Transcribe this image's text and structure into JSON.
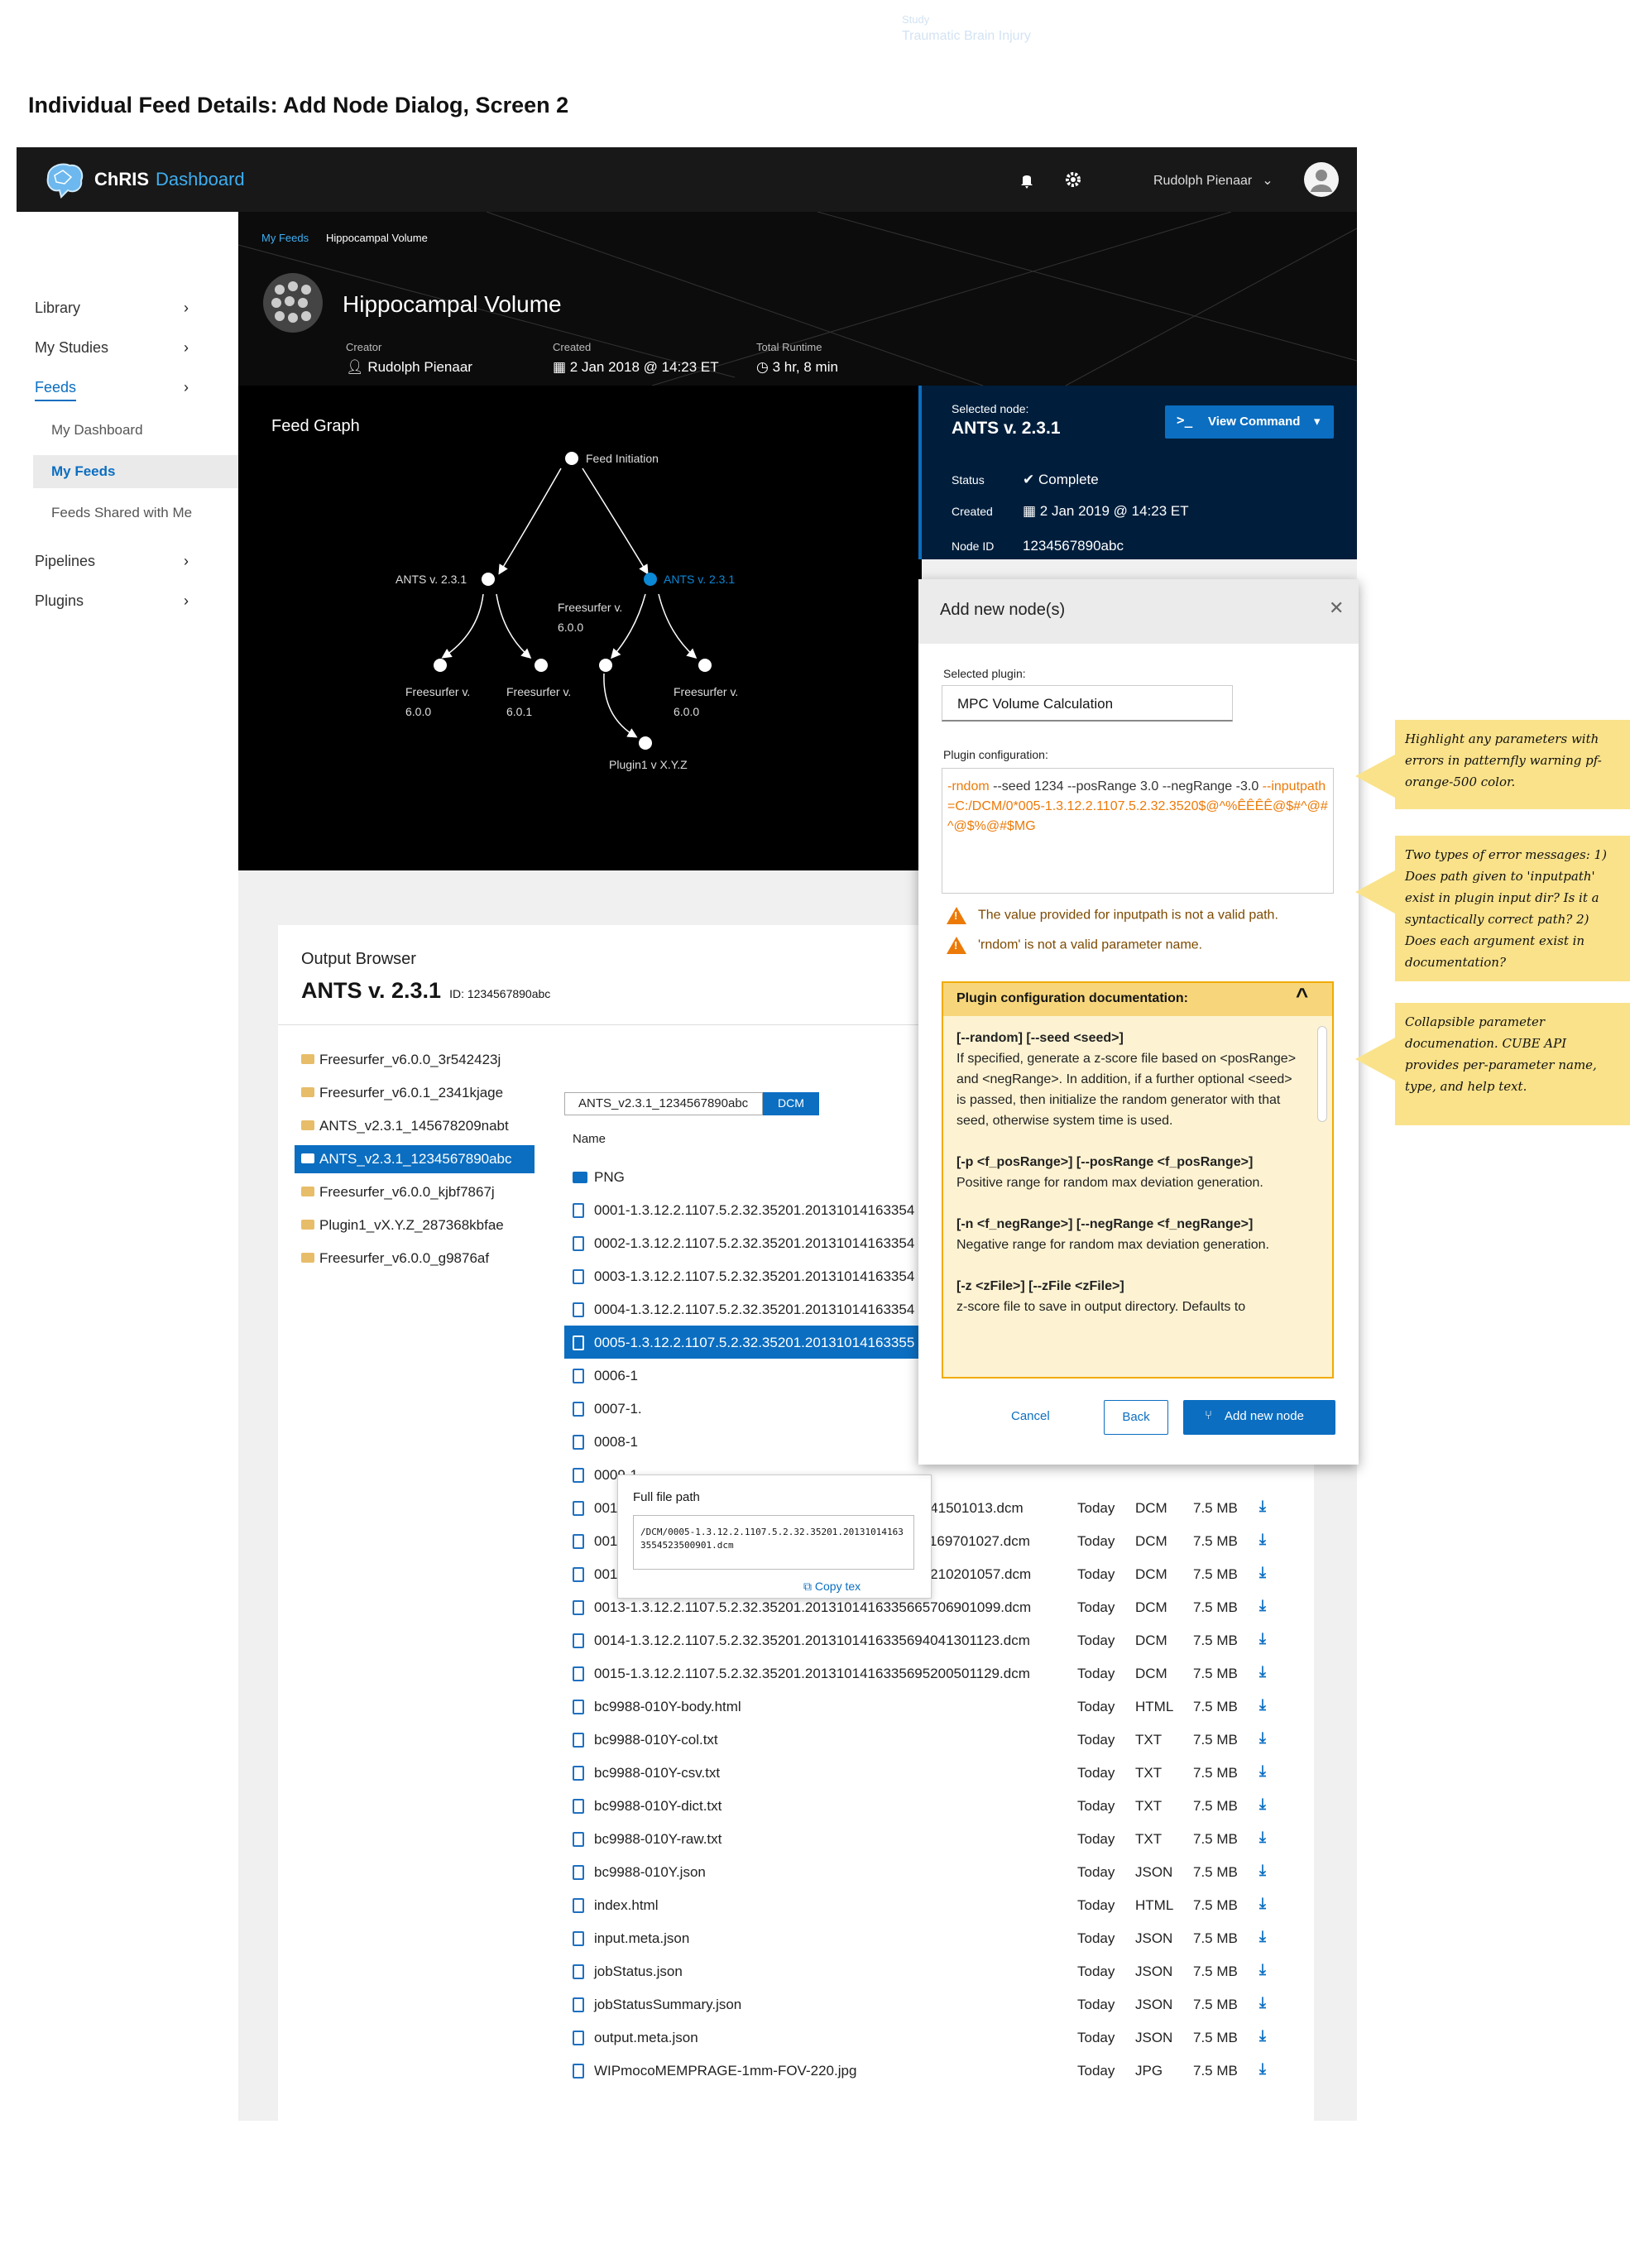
{
  "ghost": {
    "label": "Study",
    "name": "Traumatic Brain Injury"
  },
  "page_title": "Individual Feed Details: Add Node Dialog, Screen 2",
  "masthead": {
    "brand": "ChRIS",
    "brand_suffix": "Dashboard",
    "user": "Rudolph Pienaar"
  },
  "sidebar": {
    "items": [
      {
        "label": "Library"
      },
      {
        "label": "My Studies"
      },
      {
        "label": "Feeds"
      },
      {
        "label": "Pipelines"
      },
      {
        "label": "Plugins"
      }
    ],
    "sub": [
      {
        "label": "My Dashboard"
      },
      {
        "label": "My Feeds"
      },
      {
        "label": "Feeds Shared with Me"
      }
    ]
  },
  "breadcrumb": {
    "parent": "My Feeds",
    "current": "Hippocampal Volume"
  },
  "feed": {
    "title": "Hippocampal Volume",
    "creator_label": "Creator",
    "creator": "Rudolph Pienaar",
    "created_label": "Created",
    "created": "2 Jan 2018 @ 14:23 ET",
    "runtime_label": "Total Runtime",
    "runtime": "3 hr, 8 min"
  },
  "graph": {
    "title": "Feed Graph",
    "nodes": [
      {
        "label": "Feed Initiation"
      },
      {
        "label": "ANTS v. 2.3.1"
      },
      {
        "label": "ANTS v. 2.3.1"
      },
      {
        "label": "Freesurfer v. 6.0.0"
      },
      {
        "label": "Freesurfer v. 6.0.1"
      },
      {
        "label": "Freesurfer v. 6.0.0"
      },
      {
        "label": "Freesurfer v. 6.0.0"
      },
      {
        "label": "Plugin1 v X.Y.Z"
      }
    ]
  },
  "selected": {
    "label": "Selected node:",
    "name": "ANTS v. 2.3.1",
    "view_command": "View Command",
    "status_label": "Status",
    "status": "Complete",
    "created_label": "Created",
    "created": "2 Jan 2019 @ 14:23 ET",
    "nodeid_label": "Node ID",
    "nodeid": "1234567890abc"
  },
  "output": {
    "title": "Output Browser",
    "name": "ANTS v. 2.3.1",
    "id": "ID: 1234567890abc",
    "path": "ANTS_v2.3.1_1234567890abc",
    "tag": "DCM",
    "name_header": "Name",
    "folders": [
      "Freesurfer_v6.0.0_3r542423j",
      "Freesurfer_v6.0.1_2341kjage",
      "ANTS_v2.3.1_145678209nabt",
      "ANTS_v2.3.1_1234567890abc",
      "Freesurfer_v6.0.0_kjbf7867j",
      "Plugin1_vX.Y.Z_287368kbfae",
      "Freesurfer_v6.0.0_g9876af"
    ],
    "files": [
      {
        "name": "PNG",
        "date": "",
        "type": "",
        "size": ""
      },
      {
        "name": "0001-1.3.12.2.1107.5.2.32.35201.20131014163354",
        "date": "",
        "type": "",
        "size": ""
      },
      {
        "name": "0002-1.3.12.2.1107.5.2.32.35201.20131014163354",
        "date": "",
        "type": "",
        "size": ""
      },
      {
        "name": "0003-1.3.12.2.1107.5.2.32.35201.20131014163354",
        "date": "",
        "type": "",
        "size": ""
      },
      {
        "name": "0004-1.3.12.2.1107.5.2.32.35201.20131014163354",
        "date": "",
        "type": "",
        "size": ""
      },
      {
        "name": "0005-1.3.12.2.1107.5.2.32.35201.20131014163355",
        "date": "",
        "type": "",
        "size": ""
      },
      {
        "name": "0006-1",
        "date": "",
        "type": "",
        "size": ""
      },
      {
        "name": "0007-1.",
        "date": "",
        "type": "",
        "size": ""
      },
      {
        "name": "0008-1",
        "date": "",
        "type": "",
        "size": ""
      },
      {
        "name": "0009-1",
        "date": "",
        "type": "",
        "size": ""
      },
      {
        "name": "0010-1.3.12.2.1107.5.2.32.35201.2013101416335623415010​13.dcm",
        "date": "Today",
        "type": "DCM",
        "size": "7.5 MB"
      },
      {
        "name": "0011-1.3.12.2.1107.5.2.32.35201.2013101416335613169701027.dcm",
        "date": "Today",
        "type": "DCM",
        "size": "7.5 MB"
      },
      {
        "name": "0012-1.3.12.2.1107.5.2.32.35201.2013101416335632210201057.dcm",
        "date": "Today",
        "type": "DCM",
        "size": "7.5 MB"
      },
      {
        "name": "0013-1.3.12.2.1107.5.2.32.35201.2013101416335665706901099.dcm",
        "date": "Today",
        "type": "DCM",
        "size": "7.5 MB"
      },
      {
        "name": "0014-1.3.12.2.1107.5.2.32.35201.2013101416335694041301123.dcm",
        "date": "Today",
        "type": "DCM",
        "size": "7.5 MB"
      },
      {
        "name": "0015-1.3.12.2.1107.5.2.32.35201.2013101416335695200501129.dcm",
        "date": "Today",
        "type": "DCM",
        "size": "7.5 MB"
      },
      {
        "name": "bc9988-010Y-body.html",
        "date": "Today",
        "type": "HTML",
        "size": "7.5 MB"
      },
      {
        "name": "bc9988-010Y-col.txt",
        "date": "Today",
        "type": "TXT",
        "size": "7.5 MB"
      },
      {
        "name": "bc9988-010Y-csv.txt",
        "date": "Today",
        "type": "TXT",
        "size": "7.5 MB"
      },
      {
        "name": "bc9988-010Y-dict.txt",
        "date": "Today",
        "type": "TXT",
        "size": "7.5 MB"
      },
      {
        "name": "bc9988-010Y-raw.txt",
        "date": "Today",
        "type": "TXT",
        "size": "7.5 MB"
      },
      {
        "name": "bc9988-010Y.json",
        "date": "Today",
        "type": "JSON",
        "size": "7.5 MB"
      },
      {
        "name": "index.html",
        "date": "Today",
        "type": "HTML",
        "size": "7.5 MB"
      },
      {
        "name": "input.meta.json",
        "date": "Today",
        "type": "JSON",
        "size": "7.5 MB"
      },
      {
        "name": "jobStatus.json",
        "date": "Today",
        "type": "JSON",
        "size": "7.5 MB"
      },
      {
        "name": "jobStatusSummary.json",
        "date": "Today",
        "type": "JSON",
        "size": "7.5 MB"
      },
      {
        "name": "output.meta.json",
        "date": "Today",
        "type": "JSON",
        "size": "7.5 MB"
      },
      {
        "name": "WIPmocoMEMPRAGE-1mm-FOV-220.jpg",
        "date": "Today",
        "type": "JPG",
        "size": "7.5 MB"
      }
    ]
  },
  "fullpath": {
    "title": "Full file path",
    "path": "/DCM/0005-1.3.12.2.1107.5.2.32.35201.20131014163355452350090​1.dcm",
    "copy": "Copy tex"
  },
  "modal": {
    "title": "Add new node(s)",
    "plugin_label": "Selected plugin:",
    "plugin": "MPC Volume Calculation",
    "config_label": "Plugin configuration:",
    "config": {
      "p1": "-rndom",
      "p2": " --seed 1234 --posRange 3.0 --negRange -3.0 ",
      "p3": "--inputpath=C:/DCM/0*005-1.3.12.2.1107.5.2.32.3520$@^%ÊÊÊÊ@$#^@#^@$%@#$MG"
    },
    "errors": [
      "The value provided for inputpath is not a valid path.",
      "'rndom' is not a valid parameter name."
    ],
    "doc_title": "Plugin configuration documentation:",
    "doc": [
      {
        "sig": "[--random] [--seed <seed>]",
        "text": "If specified, generate a z-score file based on <posRange> and <negRange>. In addition, if a further optional <seed> is passed, then initialize the random generator with that seed, otherwise system time is used."
      },
      {
        "sig": "[-p <f_posRange>] [--posRange <f_posRange>]",
        "text": "Positive range for random max deviation generation."
      },
      {
        "sig": "[-n <f_negRange>] [--negRange <f_negRange>]",
        "text": "Negative range for random max deviation generation."
      },
      {
        "sig": "[-z <zFile>] [--zFile <zFile>]",
        "text": "z-score file to save in output directory. Defaults to"
      }
    ],
    "cancel": "Cancel",
    "back": "Back",
    "add": "Add new node"
  },
  "notes": [
    "Highlight any parameters with errors in patternfly warning pf-orange-500 color.",
    "Two types of error messages: 1) Does path given to 'inputpath' exist in plugin input dir? Is it a syntactically correct path? 2) Does each argument exist in documentation?",
    "Collapsible parameter documenation. CUBE API provides per-parameter name, type, and help text."
  ]
}
